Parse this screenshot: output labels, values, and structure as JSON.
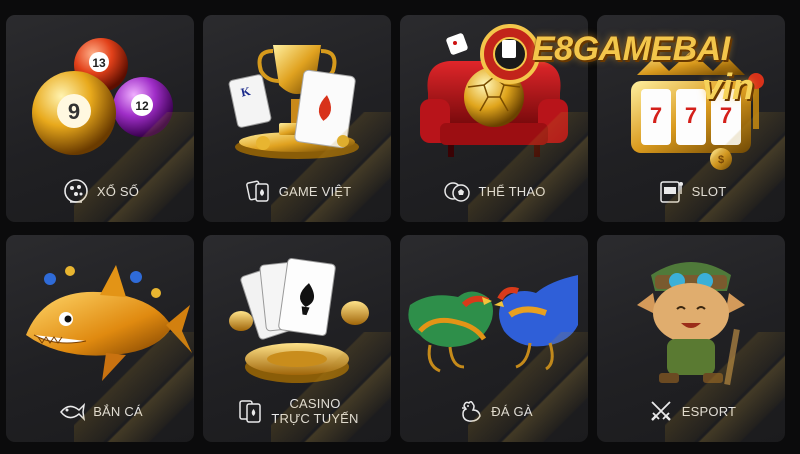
{
  "brand": {
    "logo_text": "E8GAMEBAI",
    "logo_suffix": "vin"
  },
  "tiles": [
    {
      "label": "XỔ SỐ",
      "icon": "lottery-ball-icon"
    },
    {
      "label": "GAME VIỆT",
      "icon": "cards-icon"
    },
    {
      "label": "THỂ THAO",
      "icon": "soccer-ball-icon"
    },
    {
      "label": "SLOT",
      "icon": "slot-machine-icon"
    },
    {
      "label": "BẮN CÁ",
      "icon": "fish-icon"
    },
    {
      "label_line1": "CASINO",
      "label_line2": "TRỰC TUYẾN",
      "icon": "playing-cards-icon"
    },
    {
      "label": "ĐÁ GÀ",
      "icon": "rooster-icon"
    },
    {
      "label": "ESPORT",
      "icon": "crossed-swords-icon"
    }
  ],
  "colors": {
    "background": "#0b0b0c",
    "tile": "#222225",
    "gold": "#f3c64b",
    "label": "#e9e9ea"
  }
}
